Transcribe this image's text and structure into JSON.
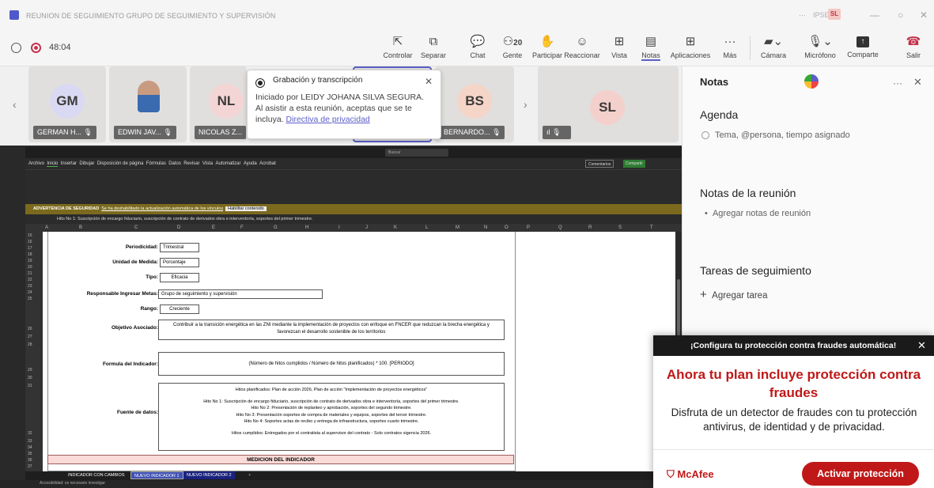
{
  "window": {
    "title": "REUNION DE SEGUIMIENTO GRUPO DE SEGUIMIENTO Y SUPERVISIÓN",
    "more": "···",
    "org": "IPSE",
    "user_initials": "SL",
    "minimize": "—",
    "maximize": "○",
    "close": "✕"
  },
  "meeting": {
    "timer": "48:04",
    "participant_count": "20"
  },
  "toolbar": {
    "controlar": "Controlar",
    "separar": "Separar",
    "chat": "Chat",
    "gente": "Gente",
    "participar": "Participar",
    "reaccionar": "Reaccionar",
    "vista": "Vista",
    "notas": "Notas",
    "aplicaciones": "Aplicaciones",
    "mas": "Más",
    "camara": "Cámara",
    "microfono": "Micrófono",
    "comparte": "Comparte",
    "salir": "Salir"
  },
  "participants": [
    {
      "initials": "GM",
      "name": "GERMAN H..."
    },
    {
      "initials": "",
      "name": "EDWIN JAV..."
    },
    {
      "initials": "NL",
      "name": "NICOLAS Z..."
    },
    {
      "initials": "BS",
      "name": "BERNARDO..."
    },
    {
      "initials": "SL",
      "name": ""
    }
  ],
  "popup": {
    "title": "Grabación y transcripción",
    "body": "Iniciado por LEIDY JOHANA SILVA SEGURA. Al asistir a esta reunión, aceptas que se te incluya.",
    "link": "Directiva de privacidad"
  },
  "excel": {
    "search": "Buscar",
    "menu": [
      "Archivo",
      "Inicio",
      "Insertar",
      "Dibujar",
      "Disposición de página",
      "Fórmulas",
      "Datos",
      "Revisar",
      "Vista",
      "Automatizar",
      "Ayuda",
      "Acrobat"
    ],
    "comments": "Comentarios",
    "share": "Compartir",
    "warning_label": "ADVERTENCIA DE SEGURIDAD",
    "warning_text": "Se ha deshabilitado la actualización automática de los vínculos",
    "warning_button": "Habilitar contenido",
    "formula": "Hito No 1: Suscripción de encargo fiduciario, suscripción de contrato de derivados obra e interventoría, soportes del primer trimestre.",
    "columns": [
      "A",
      "B",
      "C",
      "D",
      "E",
      "F",
      "G",
      "H",
      "I",
      "J",
      "K",
      "L",
      "M",
      "N",
      "O",
      "P",
      "Q",
      "R",
      "S",
      "T"
    ],
    "rows": [
      "15",
      "16",
      "17",
      "18",
      "19",
      "20",
      "21",
      "22",
      "23",
      "24",
      "25",
      "26",
      "27",
      "28",
      "29",
      "30",
      "31",
      "32",
      "33",
      "34",
      "35",
      "36",
      "37"
    ],
    "periodicidad_label": "Periodicidad:",
    "periodicidad": "Trimestral",
    "unidad_label": "Unidad de Medida:",
    "unidad": "Porcentaje",
    "tipo_label": "Tipo:",
    "tipo": "Eficacia",
    "responsable_label": "Responsable Ingresar Metas:",
    "responsable": "Grupo de seguimiento y supervisión",
    "rango_label": "Rango:",
    "rango": "Creciente",
    "objetivo_label": "Objetivo Asociado:",
    "objetivo": "Contribuir a la transición energética en las ZNI mediante la implementación de proyectos con enfoque en FNCER que reduzcan la brecha energética y favorezcan el desarrollo sostenible de los territorios",
    "formula_label": "Formula del Indicador:",
    "formula_value": "(Número de hitos cumplidos / Número de hitos planificados) * 100. [PERIODO]",
    "fuente_label": "Fuente de datos:",
    "fuente_lines": [
      "Hitos planificados: Plan de acción 2026, Plan de acción \"Implementación de proyectos energéticos\"",
      "",
      "Hito No 1: Suscripción de encargo fiduciario, suscripción de contrato de derivados obra e interventoría, soportes del primer trimestre.",
      "Hito No 2: Presentación de replanteo y aprobación, soportes del segundo trimestre.",
      "Hito No 3: Presentación soportes de compra de materiales y equipos, soportes del tercer trimestre.",
      "Hito No 4: Soportes actas de recibo y entrega de infraestructura, soportes cuarto trimestre.",
      "",
      "Hitos cumplidos: Entregados por el contratista al supervisor del contrato - Solo contratos vigencia 2026."
    ],
    "medicion": "MEDICION DEL INDICADOR",
    "tabs": [
      "INDICADOR CON CAMBIOS",
      "NUEVO INDICADOR 1",
      "NUEVO INDICADOR 2",
      "+"
    ],
    "status": "Accesibilidad: es necesario investigar"
  },
  "notes": {
    "title": "Notas",
    "more": "···",
    "close": "✕",
    "agenda": "Agenda",
    "agenda_placeholder": "Tema, @persona, tiempo asignado",
    "meeting_notes": "Notas de la reunión",
    "meeting_notes_placeholder": "Agregar notas de reunión",
    "tasks": "Tareas de seguimiento",
    "add_task": "Agregar tarea"
  },
  "mcafee": {
    "header": "¡Configura tu protección contra fraudes automática!",
    "close": "✕",
    "headline": "Ahora tu plan incluye protección contra fraudes",
    "text": "Disfruta de un detector de fraudes con tu protección antivirus, de identidad y de privacidad.",
    "logo": "McAfee",
    "button": "Activar protección",
    "accent": "#c01818"
  }
}
